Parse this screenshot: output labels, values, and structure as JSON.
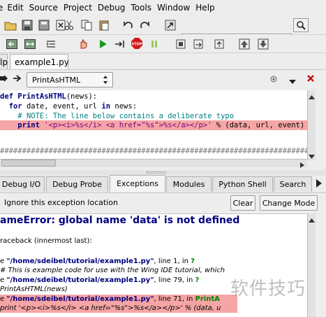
{
  "menubar": {
    "items": [
      "Edit",
      "Source",
      "Project",
      "Debug",
      "Tools",
      "Window",
      "Help"
    ],
    "partial_first": "e"
  },
  "search": {
    "value": ""
  },
  "file_tabs": [
    {
      "label": "lp",
      "active": false
    },
    {
      "label": "example1.py",
      "active": true
    }
  ],
  "nav": {
    "scope_value": "PrintAsHTML"
  },
  "editor": {
    "lines": [
      {
        "kw": "def",
        "name": "PrintAsHTML",
        "rest": "(news):"
      },
      {
        "indent": "  ",
        "kw": "for",
        "mid": " date, event, url ",
        "kw2": "in",
        "rest": " news:"
      },
      {
        "indent": "    ",
        "comment": "# NOTE: The line below contains a deliberate typo"
      },
      {
        "indent": "    ",
        "kw": "print",
        "str": " '<p><i>%s</i> <a href=\"%s\">%s</a></p>'",
        "rest": " % (data, url, event)"
      },
      {
        "hashes": "########################################################################"
      }
    ]
  },
  "panel_tabs": [
    "Debug I/O",
    "Debug Probe",
    "Exceptions",
    "Modules",
    "Python Shell",
    "Search"
  ],
  "active_panel_tab": "Exceptions",
  "exceptions": {
    "ignore_label": "Ignore this exception location",
    "clear_label": "Clear",
    "change_mode_label": "Change Mode",
    "error_title": "ameError: global name 'data' is not defined",
    "traceback_header": "raceback (innermost last):",
    "frames": [
      {
        "prefix": "e ",
        "path": "\"/home/sdeibel/tutorial/example1.py\"",
        "mid": ", line 1, in ",
        "fn": "?"
      },
      {
        "comment": "# This is example code for use with the Wing IDE tutorial, which"
      },
      {
        "prefix": "e ",
        "path": "\"/home/sdeibel/tutorial/example1.py\"",
        "mid": ", line 79, in ",
        "fn": "?"
      },
      {
        "comment": "PrintAsHTML(news)"
      },
      {
        "prefix": "e ",
        "path": "\"/home/sdeibel/tutorial/example1.py\"",
        "mid": ", line 71, in ",
        "fn": "PrintA"
      },
      {
        "comment": "print '<p><i>%s</i> <a href=\"%s\">%s</a></p>' % (data, u"
      }
    ]
  },
  "watermark": "软件技巧",
  "colors": {
    "error_highlight": "#f5a5a5",
    "keyword": "#00007f",
    "comment": "#008080",
    "string": "#7f007f"
  }
}
